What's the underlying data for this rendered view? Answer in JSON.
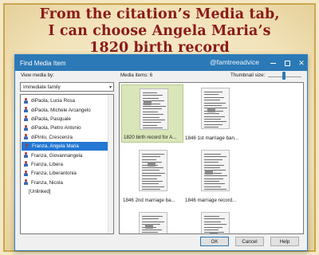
{
  "caption": {
    "line1": "From the citation’s Media tab,",
    "line2": "I can choose Angela Maria’s",
    "line3": "1820 birth record"
  },
  "window": {
    "title": "Find Media Item",
    "watermark": "@famtreeadvice",
    "close_glyph": "✕"
  },
  "left_panel": {
    "view_label": "View media by:",
    "view_selected": "Immediate family",
    "people": [
      {
        "label": "diPaola, Lucia Rosa",
        "has_icon": true
      },
      {
        "label": "diPaola, Michele Arcangelo",
        "has_icon": true
      },
      {
        "label": "diPaola, Pasquale",
        "has_icon": true
      },
      {
        "label": "diPaola, Pietro Antonio",
        "has_icon": true
      },
      {
        "label": "diPinto, Crescenza",
        "has_icon": true
      },
      {
        "label": "Franza, Angela Maria",
        "has_icon": true,
        "selected": true
      },
      {
        "label": "Franza, Giovannangela",
        "has_icon": true
      },
      {
        "label": "Franza, Libera",
        "has_icon": true
      },
      {
        "label": "Franza, Liberantonia",
        "has_icon": true
      },
      {
        "label": "Franza, Nicola",
        "has_icon": true
      },
      {
        "label": "[Unlinked]",
        "has_icon": false
      }
    ]
  },
  "right_panel": {
    "media_count": "Media items: 6",
    "thumb_size_label": "Thumbnail size:",
    "items": [
      {
        "caption": "1820 birth record for A...",
        "selected": true
      },
      {
        "caption": "1846 1st marriage ban...",
        "selected": false
      },
      {
        "caption": "1846 2nd marriage ba...",
        "selected": false
      },
      {
        "caption": "1846 marriage record...",
        "selected": false
      },
      {
        "caption": "",
        "selected": false
      },
      {
        "caption": "",
        "selected": false
      }
    ]
  },
  "buttons": {
    "ok": "OK",
    "cancel": "Cancel",
    "help": "Help"
  },
  "colors": {
    "caption_red": "#8b1a1a",
    "titlebar_blue": "#2b79b6",
    "selection_blue": "#2477d3",
    "selected_thumb_bg": "#d9e6b8"
  }
}
